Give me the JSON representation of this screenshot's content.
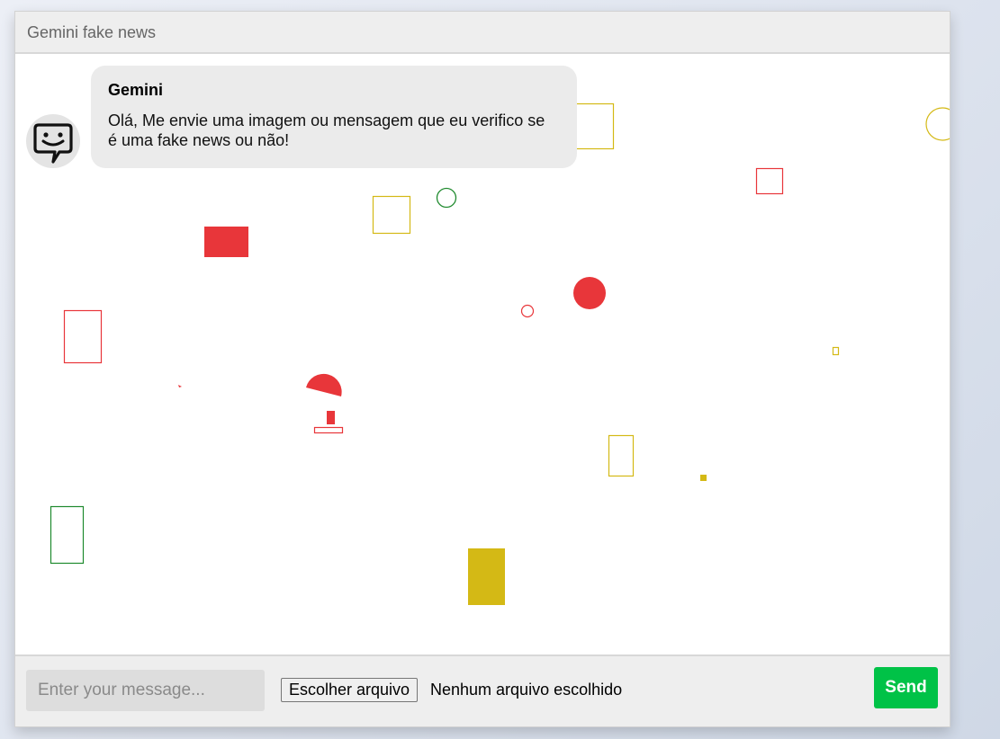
{
  "header": {
    "title": "Gemini fake news"
  },
  "messages": [
    {
      "sender": "Gemini",
      "text": "Olá, Me envie uma imagem ou mensagem que eu verifico se é uma fake news ou não!",
      "avatar_icon": "chat-bot-face-icon"
    }
  ],
  "composer": {
    "placeholder": "Enter your message...",
    "file_button_label": "Escolher arquivo",
    "file_status": "Nenhum arquivo escolhido",
    "send_label": "Send"
  },
  "colors": {
    "red": "#e8363a",
    "yellow": "#d4b915",
    "green": "#1f8a2e",
    "send": "#00c247"
  }
}
